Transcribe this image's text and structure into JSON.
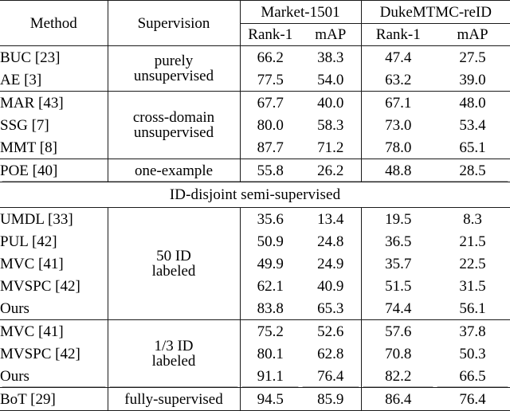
{
  "table": {
    "columns": {
      "method": "Method",
      "supervision": "Supervision",
      "market_group": "Market-1501",
      "duke_group": "DukeMTMC-reID",
      "market_rank1": "Rank-1",
      "market_map": "mAP",
      "duke_rank1": "Rank-1",
      "duke_map": "mAP"
    },
    "section_header": "ID-disjoint semi-supervised",
    "groups": [
      {
        "supervision": "purely\nunsupervised",
        "supervision_line1": "purely",
        "supervision_line2": "unsupervised",
        "rows": [
          {
            "method": "BUC [23]",
            "market_rank1": "66.2",
            "market_map": "38.3",
            "duke_rank1": "47.4",
            "duke_map": "27.5",
            "bold": false
          },
          {
            "method": "AE [3]",
            "market_rank1": "77.5",
            "market_map": "54.0",
            "duke_rank1": "63.2",
            "duke_map": "39.0",
            "bold": false
          }
        ]
      },
      {
        "supervision_line1": "cross-domain",
        "supervision_line2": "unsupervised",
        "rows": [
          {
            "method": "MAR [43]",
            "market_rank1": "67.7",
            "market_map": "40.0",
            "duke_rank1": "67.1",
            "duke_map": "48.0",
            "bold": false
          },
          {
            "method": "SSG [7]",
            "market_rank1": "80.0",
            "market_map": "58.3",
            "duke_rank1": "73.0",
            "duke_map": "53.4",
            "bold": false
          },
          {
            "method": "MMT [8]",
            "market_rank1": "87.7",
            "market_map": "71.2",
            "duke_rank1": "78.0",
            "duke_map": "65.1",
            "bold": false
          }
        ]
      },
      {
        "supervision_line1": "one-example",
        "supervision_line2": "",
        "rows": [
          {
            "method": "POE [40]",
            "market_rank1": "55.8",
            "market_map": "26.2",
            "duke_rank1": "48.8",
            "duke_map": "28.5",
            "bold": false
          }
        ]
      },
      {
        "supervision_line1": "50 ID",
        "supervision_line2": "labeled",
        "rows": [
          {
            "method": "UMDL [33]",
            "market_rank1": "35.6",
            "market_map": "13.4",
            "duke_rank1": "19.5",
            "duke_map": "8.3",
            "bold": false
          },
          {
            "method": "PUL [42]",
            "market_rank1": "50.9",
            "market_map": "24.8",
            "duke_rank1": "36.5",
            "duke_map": "21.5",
            "bold": false
          },
          {
            "method": "MVC [41]",
            "market_rank1": "49.9",
            "market_map": "24.9",
            "duke_rank1": "35.7",
            "duke_map": "22.5",
            "bold": false
          },
          {
            "method": "MVSPC [42]",
            "market_rank1": "62.1",
            "market_map": "40.9",
            "duke_rank1": "51.5",
            "duke_map": "31.5",
            "bold": false
          },
          {
            "method": "Ours",
            "market_rank1": "83.8",
            "market_map": "65.3",
            "duke_rank1": "74.4",
            "duke_map": "56.1",
            "bold": true
          }
        ]
      },
      {
        "supervision_line1": "1/3 ID",
        "supervision_line2": "labeled",
        "rows": [
          {
            "method": "MVC [41]",
            "market_rank1": "75.2",
            "market_map": "52.6",
            "duke_rank1": "57.6",
            "duke_map": "37.8",
            "bold": false
          },
          {
            "method": "MVSPC [42]",
            "market_rank1": "80.1",
            "market_map": "62.8",
            "duke_rank1": "70.8",
            "duke_map": "50.3",
            "bold": false
          },
          {
            "method": "Ours",
            "market_rank1": "91.1",
            "market_map": "76.4",
            "duke_rank1": "82.2",
            "duke_map": "66.5",
            "bold": true
          }
        ]
      },
      {
        "supervision_line1": "fully-supervised",
        "supervision_line2": "",
        "rows": [
          {
            "method": "BoT [29]",
            "market_rank1": "94.5",
            "market_map": "85.9",
            "duke_rank1": "86.4",
            "duke_map": "76.4",
            "bold": false
          }
        ]
      }
    ]
  }
}
